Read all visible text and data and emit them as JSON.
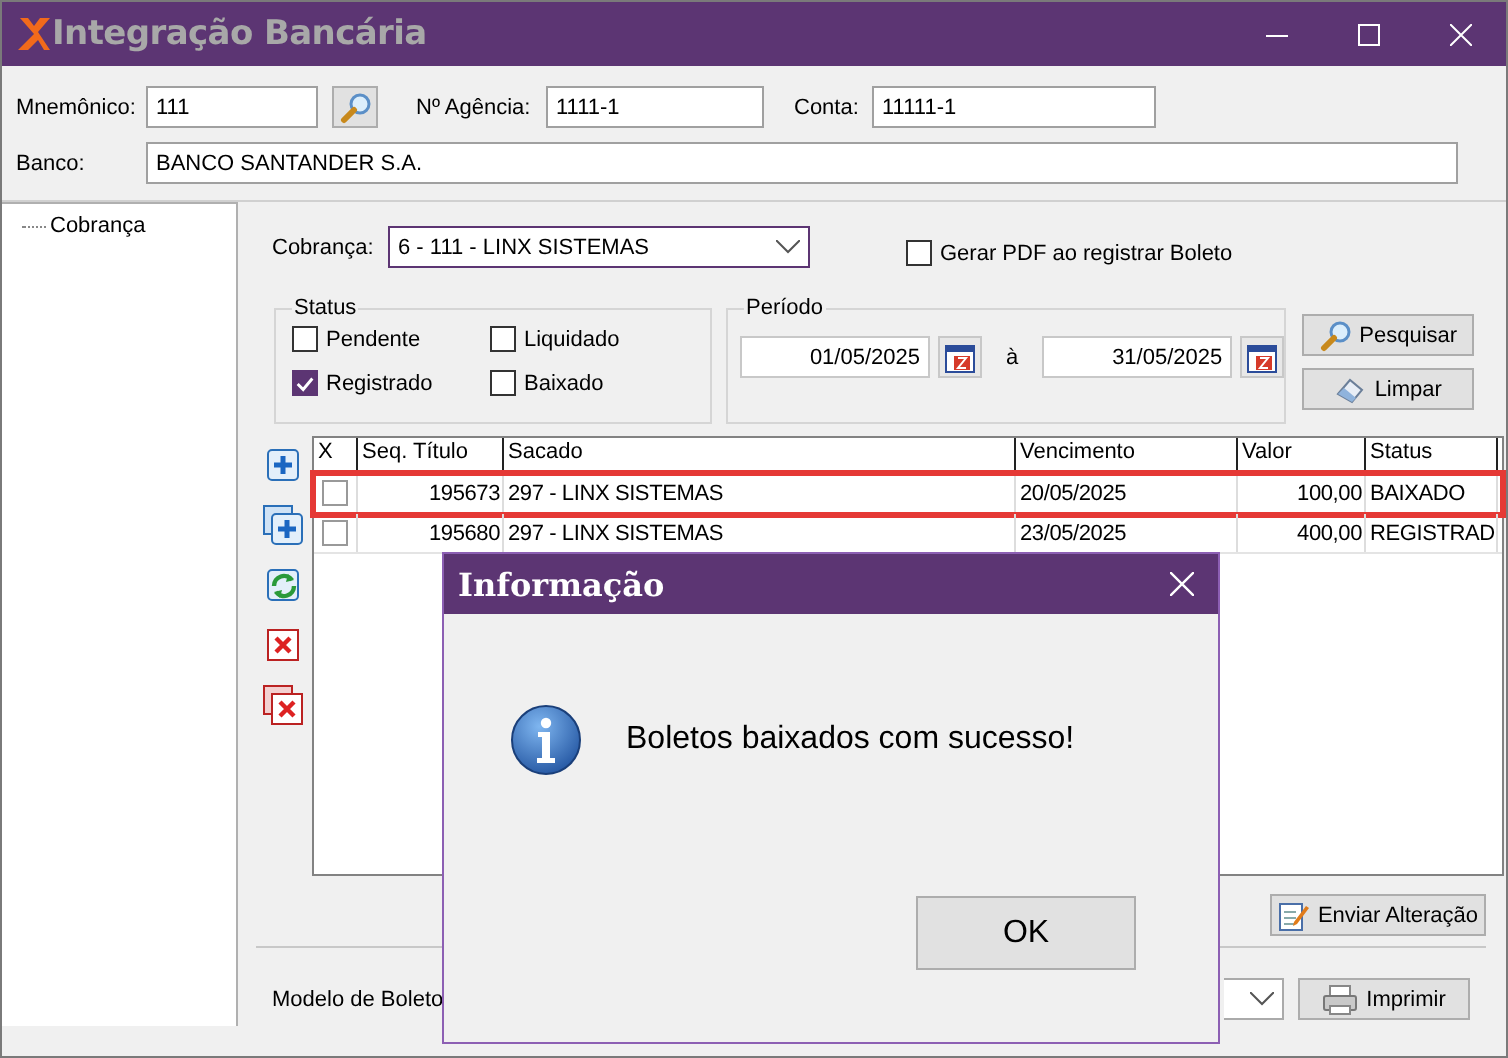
{
  "window": {
    "title": "Integração Bancária"
  },
  "header": {
    "fields": [
      {
        "label": "Mnemônico:",
        "value": "111"
      },
      {
        "label": "Nº Agência:",
        "value": "1111-1"
      },
      {
        "label": "Conta:",
        "value": "11111-1"
      }
    ],
    "bank": {
      "label": "Banco:",
      "value": "BANCO SANTANDER S.A."
    }
  },
  "tree": [
    {
      "label": "Cobrança"
    }
  ],
  "cobranca": {
    "label": "Cobrança:",
    "value": "6 - 111 - LINX SISTEMAS"
  },
  "gerar_pdf": {
    "label": "Gerar PDF ao registrar Boleto",
    "checked": false
  },
  "status": {
    "title": "Status",
    "options": [
      {
        "label": "Pendente",
        "checked": false
      },
      {
        "label": "Liquidado",
        "checked": false
      },
      {
        "label": "Registrado",
        "checked": true
      },
      {
        "label": "Baixado",
        "checked": false
      }
    ]
  },
  "periodo": {
    "title": "Período",
    "from": "01/05/2025",
    "separator": "à",
    "to": "31/05/2025"
  },
  "buttons": [
    {
      "label": "Pesquisar",
      "kind": "search"
    },
    {
      "label": "Limpar",
      "kind": "clear"
    }
  ],
  "table": {
    "columns": [
      "X",
      "Seq. Título",
      "Sacado",
      "Vencimento",
      "Valor",
      "Status"
    ],
    "rows": [
      {
        "checked": false,
        "highlighted": true,
        "cells": [
          "",
          "195673",
          "297 - LINX SISTEMAS",
          "20/05/2025",
          "100,00",
          "BAIXADO"
        ]
      },
      {
        "checked": false,
        "highlighted": false,
        "cells": [
          "",
          "195680",
          "297 - LINX SISTEMAS",
          "23/05/2025",
          "400,00",
          "REGISTRAD"
        ]
      }
    ]
  },
  "send_button": "Enviar Alteração",
  "modelo": {
    "label": "Modelo de Boleto"
  },
  "print_button": "Imprimir",
  "dialog": {
    "title": "Informação",
    "message": "Boletos baixados com sucesso!",
    "button": "OK"
  }
}
